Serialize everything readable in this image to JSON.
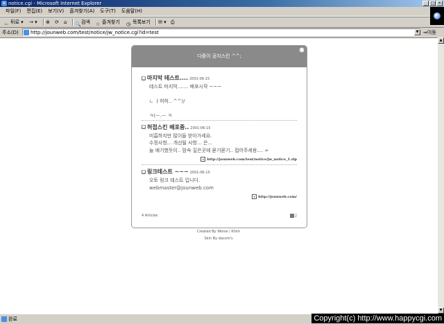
{
  "window": {
    "title": "notice.cgi - Microsoft Internet Explorer",
    "controls": [
      "_",
      "□",
      "×"
    ]
  },
  "menu": [
    "파일(F)",
    "편집(E)",
    "보기(V)",
    "즐겨찾기(A)",
    "도구(T)",
    "도움말(H)"
  ],
  "toolbar": {
    "back": "뒤로",
    "forward": "→",
    "stop": "⊗",
    "refresh": "⟳",
    "home": "⌂",
    "search": "검색",
    "favorites": "즐겨찾기",
    "history": "목록보기",
    "mail": "✉"
  },
  "address": {
    "label": "주소(D)",
    "url": "http://jounweb.com/test/notice/jw_notice.cgi?id=test",
    "go": "이동"
  },
  "board": {
    "header": "다줌이 공지스킨 ^^;",
    "posts": [
      {
        "title": "마지막 테스트....",
        "date": "2001-06-15",
        "body": "테스트 마지막....... 배포시작 ~~~\n\nㄴ ㅏ허허.. ^^)/\n\nㅋ(ㅡ.ㅡ ㅋ",
        "attachment": ""
      },
      {
        "title": "허접스킨 배포중..",
        "date": "2001-06-15",
        "body": "미흡하지만 많이들 받아가세요.\n수정사항... 개선될 사항... 은...\n늘 얘기했듯이.. 맘속 깊은곳에 묻기묻기.. 접어주세용.... ∞",
        "attachment": "http://jounweb.com/test/notice/jw_notice_1.zip"
      },
      {
        "title": "링크테스트",
        "suffix": "~~~",
        "date": "2001-06-15",
        "body": "오토 링크 테스트 입니다.\nwebmaster@jounweb.com",
        "attachment": "http://jounweb.com/"
      }
    ],
    "article_count": "4 Articles",
    "page": "2"
  },
  "credits": {
    "line1": "Created By Wonie / Khim",
    "line2": "Skin By dacom's"
  },
  "status": {
    "text": "완료"
  },
  "watermark": "Copyright(c) http://www.happycgi.com"
}
